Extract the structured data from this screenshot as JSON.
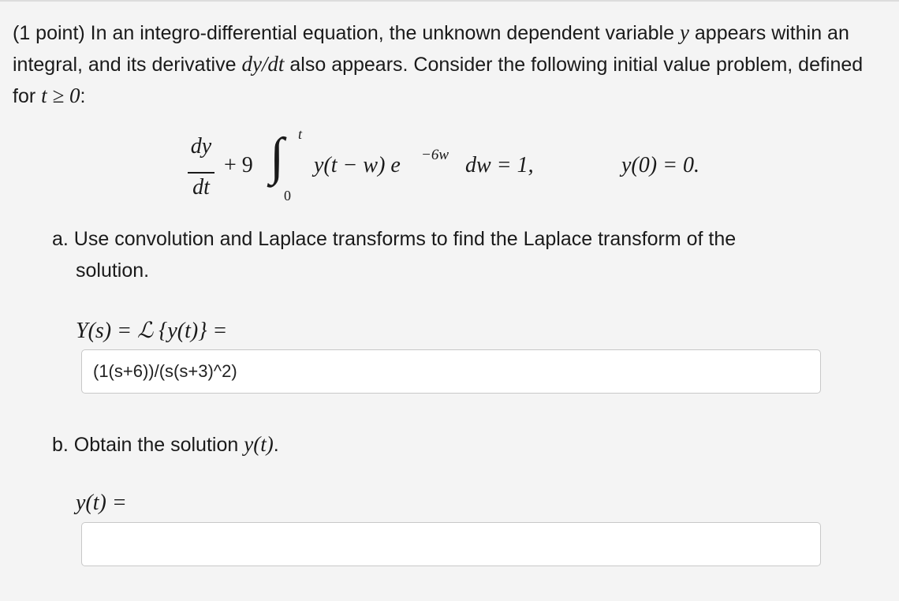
{
  "problem": {
    "intro_part1": "(1 point) In an integro-differential equation, the unknown dependent variable ",
    "intro_var_y": "y",
    "intro_part2": " appears within an integral, and its derivative ",
    "intro_deriv": "dy/dt",
    "intro_part3": " also appears. Consider the following initial value problem, defined for ",
    "intro_cond": "t ≥ 0",
    "intro_part4": ":"
  },
  "equation": {
    "numerator": "dy",
    "denominator": "dt",
    "plus_coeff": "+ 9",
    "integral_symbol": "∫",
    "upper_limit": "t",
    "lower_limit": "0",
    "integrand": "y(t − w) e",
    "exponent": "−6w",
    "differential_rhs": "dw = 1,",
    "initial_condition": "y(0) = 0."
  },
  "part_a": {
    "text": "a. Use convolution and Laplace transforms to find the Laplace transform of the",
    "text_cont": "solution.",
    "label": "Y(s) = ℒ {y(t)} =",
    "answer_value": "(1(s+6))/(s(s+3)^2)"
  },
  "part_b": {
    "text": "b. Obtain the solution ",
    "text_var": "y(t)",
    "text_end": ".",
    "label": "y(t) =",
    "answer_value": ""
  }
}
